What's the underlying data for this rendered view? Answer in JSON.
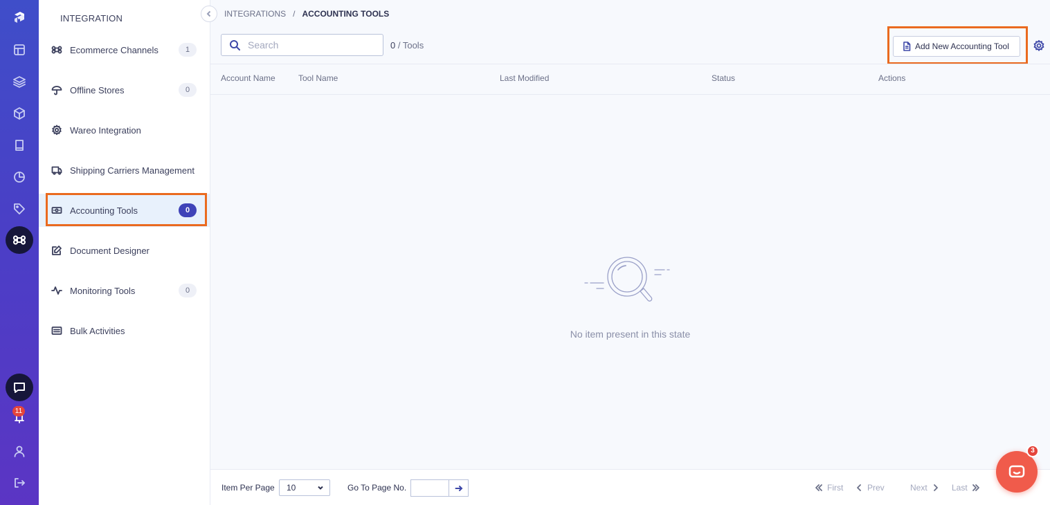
{
  "rail": {
    "items": [
      {
        "icon": "logo-icon"
      },
      {
        "icon": "dashboard-icon"
      },
      {
        "icon": "layers-icon"
      },
      {
        "icon": "box-icon"
      },
      {
        "icon": "book-icon"
      },
      {
        "icon": "pie-chart-icon"
      },
      {
        "icon": "tag-icon"
      },
      {
        "icon": "command-icon",
        "active": true
      }
    ],
    "notification_count": "11",
    "bottom": [
      "chat-icon",
      "bell-icon",
      "user-icon",
      "logout-icon"
    ]
  },
  "sidebar": {
    "title": "INTEGRATION",
    "items": [
      {
        "label": "Ecommerce Channels",
        "count": "1",
        "icon": "command-icon"
      },
      {
        "label": "Offline Stores",
        "count": "0",
        "icon": "umbrella-icon"
      },
      {
        "label": "Wareo Integration",
        "count": "",
        "icon": "gear-icon"
      },
      {
        "label": "Shipping Carriers Management",
        "count": "",
        "icon": "truck-icon"
      },
      {
        "label": "Accounting Tools",
        "count": "0",
        "icon": "cash-icon",
        "active": true
      },
      {
        "label": "Document Designer",
        "count": "",
        "icon": "edit-icon"
      },
      {
        "label": "Monitoring Tools",
        "count": "0",
        "icon": "activity-icon"
      },
      {
        "label": "Bulk Activities",
        "count": "",
        "icon": "list-box-icon"
      }
    ]
  },
  "breadcrumb": {
    "parent": "INTEGRATIONS",
    "separator": "/",
    "current": "ACCOUNTING TOOLS"
  },
  "toolbar": {
    "search_placeholder": "Search",
    "count_value": "0",
    "count_unit": "/ Tools",
    "add_button_label": "Add New Accounting Tool"
  },
  "table": {
    "columns": [
      "Account Name",
      "Tool Name",
      "Last Modified",
      "Status",
      "Actions"
    ],
    "rows": [],
    "empty_message": "No item present in this state"
  },
  "pagination": {
    "items_per_page_label": "Item Per Page",
    "items_per_page_value": "10",
    "go_to_page_label": "Go To Page No.",
    "first_label": "First",
    "prev_label": "Prev",
    "next_label": "Next",
    "last_label": "Last"
  },
  "chat_widget": {
    "badge_count": "3"
  },
  "colors": {
    "rail_gradient_top": "#3f4ec9",
    "rail_gradient_bottom": "#5b35c4",
    "accent": "#3f43b8",
    "highlight": "#ea6a1f",
    "chat_fab": "#f05b4b"
  }
}
